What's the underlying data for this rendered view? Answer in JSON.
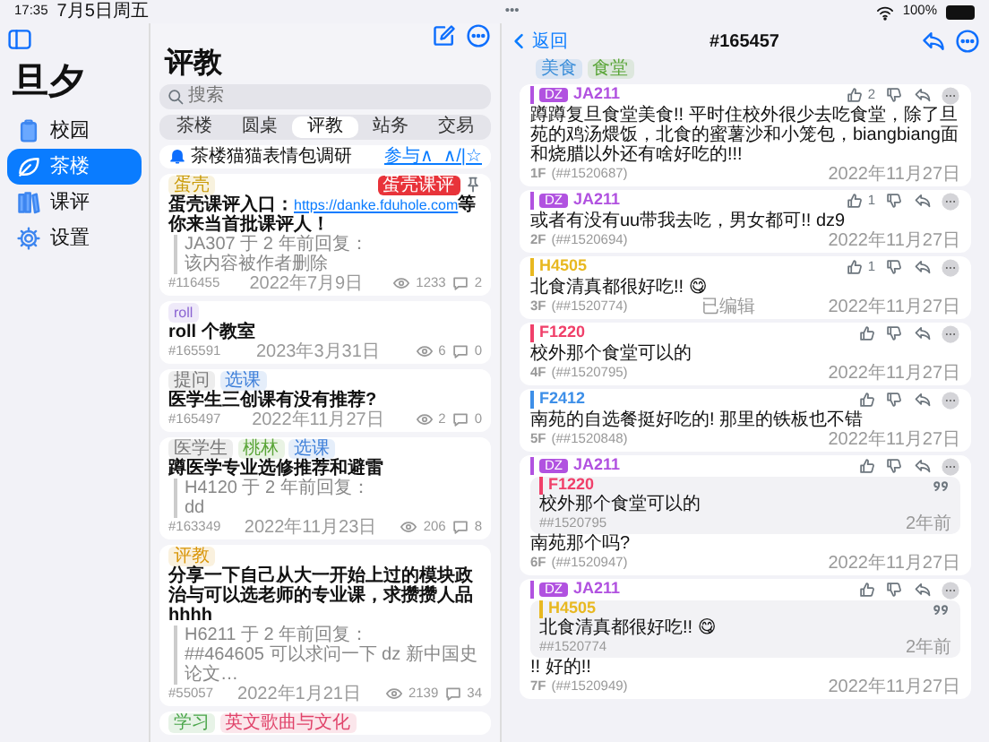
{
  "status_bar": {
    "time": "17:35",
    "date": "7月5日周五",
    "dots": "•••",
    "battery": "100%"
  },
  "sidebar": {
    "title": "旦夕",
    "items": [
      {
        "label": "校园",
        "selected": false
      },
      {
        "label": "茶楼",
        "selected": true
      },
      {
        "label": "课评",
        "selected": false
      },
      {
        "label": "设置",
        "selected": false
      }
    ]
  },
  "list": {
    "title": "评教",
    "search": {
      "placeholder": "搜索"
    },
    "segments": [
      {
        "label": "茶楼",
        "selected": false
      },
      {
        "label": "圆桌",
        "selected": false
      },
      {
        "label": "评教",
        "selected": true
      },
      {
        "label": "站务",
        "selected": false
      },
      {
        "label": "交易",
        "selected": false
      }
    ],
    "notice": {
      "text": "茶楼猫猫表情包调研",
      "link": "参与∧_∧/|☆"
    },
    "posts": [
      {
        "tags": [
          {
            "label": "蛋壳",
            "color": "#c99a06"
          }
        ],
        "badge": "蛋壳课评",
        "pinned": true,
        "text": "蛋壳课评入口：",
        "link": "https://danke.fduhole.com",
        "text_after": "等你来当首批课评人！",
        "quote": {
          "header": "JA307 于 2 年前回复：",
          "body": "该内容被作者删除"
        },
        "id": "#116455",
        "date": "2022年7月9日",
        "views": "1233",
        "comments": "2"
      },
      {
        "tags": [
          {
            "label": "roll",
            "color": "#8a63d2"
          }
        ],
        "text": "roll 个教室",
        "id": "#165591",
        "date": "2023年3月31日",
        "views": "6",
        "comments": "0"
      },
      {
        "tags": [
          {
            "label": "提问",
            "color": "#777777"
          },
          {
            "label": "选课",
            "color": "#3d7fd9"
          }
        ],
        "text": "医学生三创课有没有推荐?",
        "id": "#165497",
        "date": "2022年11月27日",
        "views": "2",
        "comments": "0"
      },
      {
        "tags": [
          {
            "label": "医学生",
            "color": "#777777"
          },
          {
            "label": "桃林",
            "color": "#5aa538"
          },
          {
            "label": "选课",
            "color": "#3d7fd9"
          }
        ],
        "text": "蹲医学专业选修推荐和避雷",
        "quote": {
          "header": "H4120 于 2 年前回复：",
          "body": "dd"
        },
        "id": "#163349",
        "date": "2022年11月23日",
        "views": "206",
        "comments": "8"
      },
      {
        "tags": [
          {
            "label": "评教",
            "color": "#d9960a"
          }
        ],
        "text": "分享一下自己从大一开始上过的模块政治与可以选老师的专业课，求攒攒人品 hhhh",
        "quote": {
          "header": "H6211 于 2 年前回复：",
          "body": "##464605 可以求问一下 dz 新中国史论文…"
        },
        "id": "#55057",
        "date": "2022年1月21日",
        "views": "2139",
        "comments": "34"
      },
      {
        "tags": [
          {
            "label": "学习",
            "color": "#4aa54a"
          },
          {
            "label": "英文歌曲与文化",
            "color": "#e0436a"
          }
        ]
      }
    ]
  },
  "detail": {
    "back": "返回",
    "title": "#165457",
    "tags": [
      {
        "label": "美食",
        "color": "#3d8fd9"
      },
      {
        "label": "食堂",
        "color": "#5aa538"
      }
    ],
    "floors": [
      {
        "author": "JA211",
        "color": "#b152e0",
        "dz": "DZ",
        "likes": "2",
        "text": "蹲蹲复旦食堂美食!!  平时住校外很少去吃食堂，除了旦苑的鸡汤煨饭，北食的蜜薯沙和小笼包，biangbiang面和烧腊以外还有啥好吃的!!!",
        "floor": "1F",
        "id": "(##1520687)",
        "date": "2022年11月27日"
      },
      {
        "author": "JA211",
        "color": "#b152e0",
        "dz": "DZ",
        "likes": "1",
        "text": "或者有没有uu带我去吃，男女都可!!  dz9",
        "floor": "2F",
        "id": "(##1520694)",
        "date": "2022年11月27日"
      },
      {
        "author": "H4505",
        "color": "#e8b820",
        "likes": "1",
        "text": "北食清真都很好吃!! 😋",
        "floor": "3F",
        "id": "(##1520774)",
        "edited": "已编辑",
        "date": "2022年11月27日"
      },
      {
        "author": "F1220",
        "color": "#f0406a",
        "text": "校外那个食堂可以的",
        "floor": "4F",
        "id": "(##1520795)",
        "date": "2022年11月27日"
      },
      {
        "author": "F2412",
        "color": "#3d8fe8",
        "text": "南苑的自选餐挺好吃的! 那里的铁板也不错",
        "floor": "5F",
        "id": "(##1520848)",
        "date": "2022年11月27日"
      },
      {
        "author": "JA211",
        "color": "#b152e0",
        "dz": "DZ",
        "quote": {
          "author": "F1220",
          "color": "#f0406a",
          "text": "校外那个食堂可以的",
          "id": "##1520795",
          "time": "2年前"
        },
        "text": "南苑那个吗?",
        "floor": "6F",
        "id": "(##1520947)",
        "date": "2022年11月27日"
      },
      {
        "author": "JA211",
        "color": "#b152e0",
        "dz": "DZ",
        "quote": {
          "author": "H4505",
          "color": "#e8b820",
          "text": "北食清真都很好吃!! 😋",
          "id": "##1520774",
          "time": "2年前"
        },
        "text": "!! 好的!!",
        "floor": "7F",
        "id": "(##1520949)",
        "date": "2022年11月27日"
      }
    ]
  }
}
